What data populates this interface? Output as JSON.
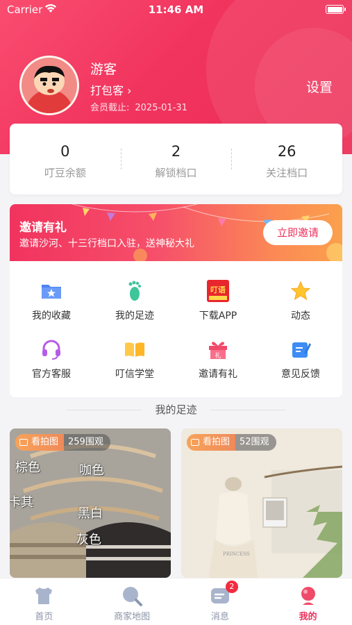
{
  "status_bar": {
    "carrier": "Carrier",
    "time": "11:46 AM"
  },
  "profile": {
    "username": "游客",
    "role": "打包客",
    "member_expiry_label": "会员截止:",
    "member_expiry_date": "2025-01-31",
    "settings_label": "设置"
  },
  "stats": [
    {
      "value": "0",
      "label": "叮豆余额"
    },
    {
      "value": "2",
      "label": "解锁档口"
    },
    {
      "value": "26",
      "label": "关注档口"
    }
  ],
  "invite_banner": {
    "title": "邀请有礼",
    "subtitle": "邀请沙河、十三行档口入驻，送神秘大礼",
    "button_label": "立即邀请"
  },
  "grid_menu": [
    {
      "label": "我的收藏",
      "icon": "folder-star-icon"
    },
    {
      "label": "我的足迹",
      "icon": "footprint-icon"
    },
    {
      "label": "下载APP",
      "icon": "app-logo-icon",
      "icon_text": "叮语"
    },
    {
      "label": "动态",
      "icon": "star-icon"
    },
    {
      "label": "官方客服",
      "icon": "headset-icon"
    },
    {
      "label": "叮信学堂",
      "icon": "open-book-icon"
    },
    {
      "label": "邀请有礼",
      "icon": "gift-icon",
      "icon_text": "礼"
    },
    {
      "label": "意见反馈",
      "icon": "feedback-edit-icon"
    }
  ],
  "section_title": "我的足迹",
  "products": [
    {
      "tag_type": "看拍图",
      "views": "259围观",
      "color_labels": [
        "棕色",
        "咖色",
        "卡其",
        "黑白",
        "灰色"
      ]
    },
    {
      "tag_type": "看拍图",
      "views": "52围观",
      "watermark": "PRINCESS"
    }
  ],
  "tab_bar": [
    {
      "label": "首页",
      "icon": "home-shirt-icon",
      "active": false
    },
    {
      "label": "商家地图",
      "icon": "map-search-icon",
      "active": false
    },
    {
      "label": "消息",
      "icon": "message-icon",
      "badge": "2",
      "active": false
    },
    {
      "label": "我的",
      "icon": "profile-icon",
      "active": true
    }
  ],
  "colors": {
    "brand": "#ee2f5a",
    "accent_orange": "#fba04d",
    "tab_inactive": "#8a93a6"
  }
}
